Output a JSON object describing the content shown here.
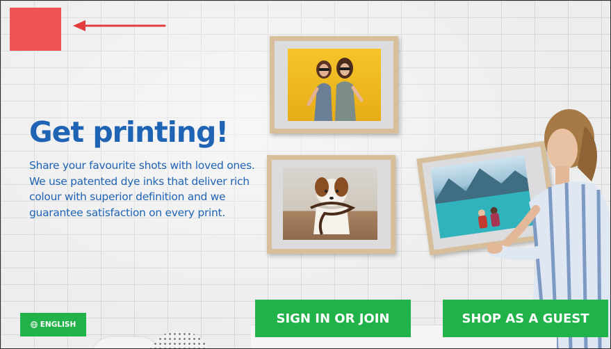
{
  "hero": {
    "headline": "Get printing!",
    "tagline": "Share your favourite shots with loved ones. We use patented dye inks that deliver rich colour with superior definition and we guarantee satisfaction on every print."
  },
  "buttons": {
    "language_label": "ENGLISH",
    "sign_in_label": "SIGN IN OR JOIN",
    "guest_label": "SHOP AS A GUEST"
  },
  "icons": {
    "language": "globe-icon",
    "pointer": "arrow-left-icon"
  },
  "colors": {
    "brand_blue": "#1f63b4",
    "button_green": "#21b24a",
    "logo_placeholder": "#f05356",
    "arrow_red": "#e23c3f"
  }
}
